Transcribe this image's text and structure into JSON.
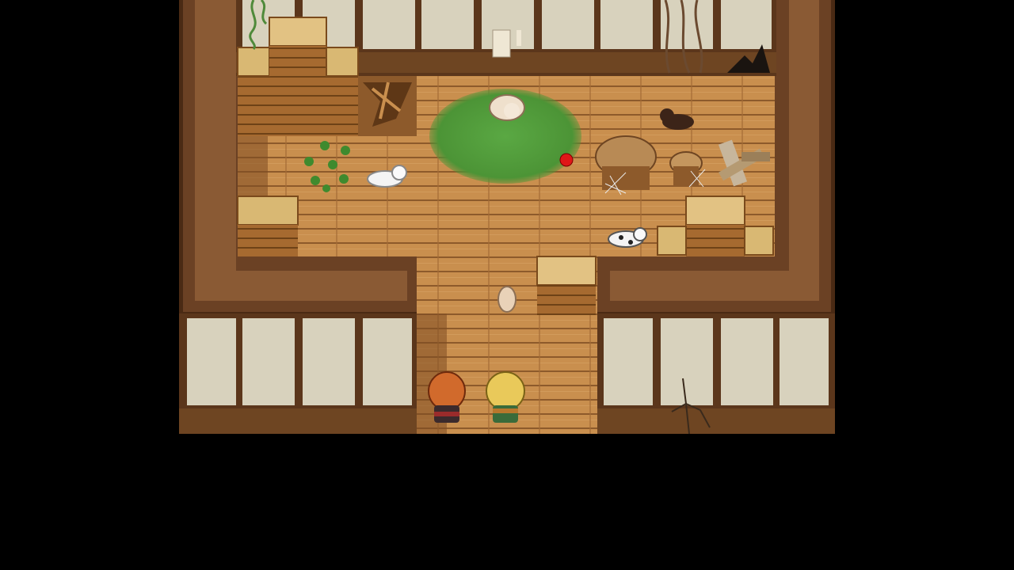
{
  "scene": {
    "type": "rpg-top-down-map",
    "location": "wooden-shelter-interior",
    "colors": {
      "background": "#000000",
      "wall_outer": "#6b4124",
      "wall_inner": "#8a5a34",
      "wall_trim": "#4a2a14",
      "floor_plank": "#c98f4e",
      "floor_seam": "#8d5a2b",
      "paper_panel": "#d8d2bd",
      "grass": "#4f9a3a",
      "ball": "#e01818"
    },
    "sprites": [
      "beige-puppy",
      "white-dog",
      "dalmatian-dog",
      "brown-dog",
      "small-tan-puppy",
      "orange-haired-hero",
      "blonde-companion",
      "red-ball",
      "broken-crate",
      "crates",
      "round-table",
      "stool",
      "broken-planks",
      "cobweb",
      "sprouts",
      "vines",
      "wall-crack"
    ]
  }
}
